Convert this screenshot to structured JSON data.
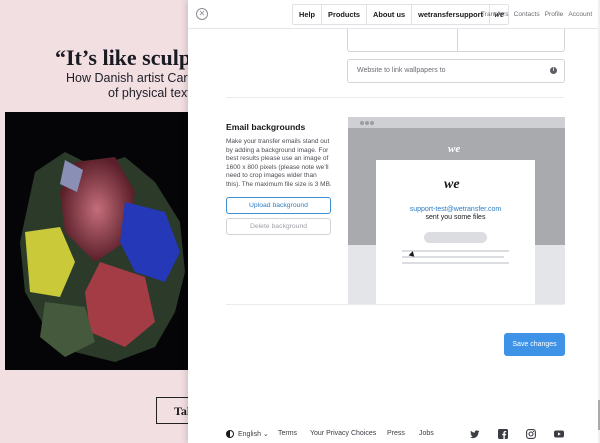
{
  "background": {
    "quote": "“It’s like sculptin",
    "subtitle_line1": "How Danish artist Carolin",
    "subtitle_line2": "of physical textur",
    "cta": "Tak"
  },
  "topbar": {
    "nav": [
      "Help",
      "Products",
      "About us",
      "wetransfersupport"
    ],
    "logo": "we",
    "links": [
      "Transfers",
      "Contacts",
      "Profile",
      "Account"
    ]
  },
  "fields": {
    "website_placeholder": "Website to link wallpapers to",
    "info_glyph": "i"
  },
  "email_backgrounds": {
    "title": "Email backgrounds",
    "description": "Make your transfer emails stand out by adding a background image. For best results please use an image of 1600 x 800 pixels (please note we’ll need to crop images wider than this). The maximum file size is 3 MB.",
    "upload_label": "Upload background",
    "delete_label": "Delete background"
  },
  "preview": {
    "logo": "we",
    "email": "support-test@wetransfer.com",
    "sent_text": "sent you some files"
  },
  "save_label": "Save changes",
  "footer": {
    "language": "English",
    "links": [
      "Terms",
      "Your Privacy Choices",
      "Press",
      "Jobs"
    ],
    "social_icons": [
      "twitter-icon",
      "facebook-icon",
      "instagram-icon",
      "youtube-icon"
    ]
  },
  "colors": {
    "accent": "#3f93e6",
    "link": "#2d7ec4",
    "page_bg": "#f2dfe2"
  }
}
